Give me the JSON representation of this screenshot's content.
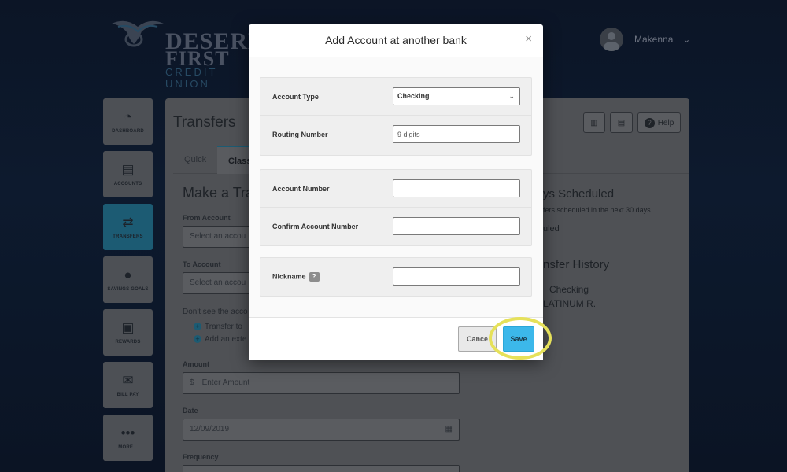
{
  "brand": {
    "line1": "DESERET",
    "line2": "FIRST",
    "line3": "CREDIT UNION"
  },
  "user": {
    "name": "Makenna"
  },
  "sidebar": {
    "items": [
      {
        "label": "DASHBOARD",
        "icon": "gauge-icon"
      },
      {
        "label": "ACCOUNTS",
        "icon": "wallet-icon"
      },
      {
        "label": "TRANSFERS",
        "icon": "transfer-icon"
      },
      {
        "label": "SAVINGS GOALS",
        "icon": "piggy-bank-icon"
      },
      {
        "label": "REWARDS",
        "icon": "gift-icon"
      },
      {
        "label": "BILL PAY",
        "icon": "bill-icon"
      },
      {
        "label": "MORE...",
        "icon": "more-dots-icon"
      }
    ]
  },
  "page": {
    "title": "Transfers",
    "tabs": [
      "Quick",
      "Class"
    ],
    "help_label": "Help",
    "heading": "Make a Tra",
    "from_label": "From Account",
    "from_placeholder": "Select an accou",
    "to_label": "To Account",
    "to_placeholder": "Select an accou",
    "dont_see": "Don't see the acco",
    "link1": "Transfer to",
    "link2": "Add an exte",
    "amount_label": "Amount",
    "amount_placeholder": "Enter Amount",
    "currency": "$",
    "date_label": "Date",
    "date_value": "12/09/2019",
    "frequency_label": "Frequency",
    "scheduled_title": "ys Scheduled",
    "scheduled_sub": "fers scheduled in the next 30 days",
    "scheduled_none": "uled",
    "history_title": "nsfer History",
    "history_item1": "Checking",
    "history_item2": "LATINUM R."
  },
  "modal": {
    "title": "Add Account at another bank",
    "close": "×",
    "account_type_label": "Account Type",
    "account_type_value": "Checking",
    "routing_label": "Routing Number",
    "routing_placeholder": "9 digits",
    "account_number_label": "Account Number",
    "confirm_account_label": "Confirm Account Number",
    "nickname_label": "Nickname",
    "nickname_help": "?",
    "cancel_label": "Cance",
    "save_label": "Save"
  },
  "colors": {
    "save": "#3cb8ea",
    "highlight": "#e6e15a",
    "accent": "#1c5b73"
  }
}
